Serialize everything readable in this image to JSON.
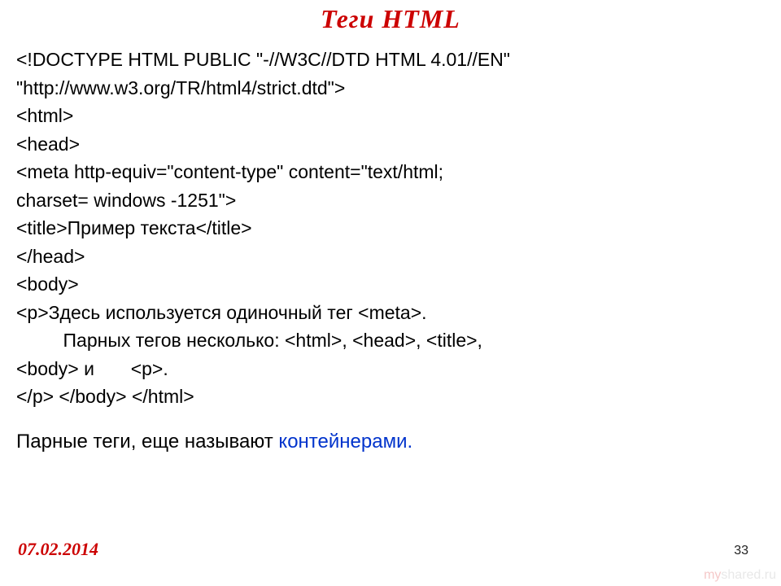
{
  "title": "Теги HTML",
  "code_lines": {
    "l1": "<!DOCTYPE HTML PUBLIC \"-//W3C//DTD HTML 4.01//EN\"",
    "l2": "\"http://www.w3.org/TR/html4/strict.dtd\">",
    "l3": "<html>",
    "l4": "<head>",
    "l5": "<meta http-equiv=\"content-type\" content=\"text/html;",
    "l6": "charset= windows -1251\">",
    "l7": "<title>Пример текста</title>",
    "l8": "</head>",
    "l9": "<body>",
    "l10": "<p>Здесь используется одиночный тег <meta>.",
    "l11": "         Парных тегов несколько: <html>, <head>, <title>,",
    "l12": "<body> и       <p>.",
    "l13": "</p> </body> </html>"
  },
  "footer_text_1": "Парные теги, еще называют  ",
  "footer_highlight": "контейнерами.",
  "date": "07.02.2014",
  "page_number": "33",
  "watermark_my": "my",
  "watermark_shared": "shared",
  "watermark_ru": ".ru"
}
